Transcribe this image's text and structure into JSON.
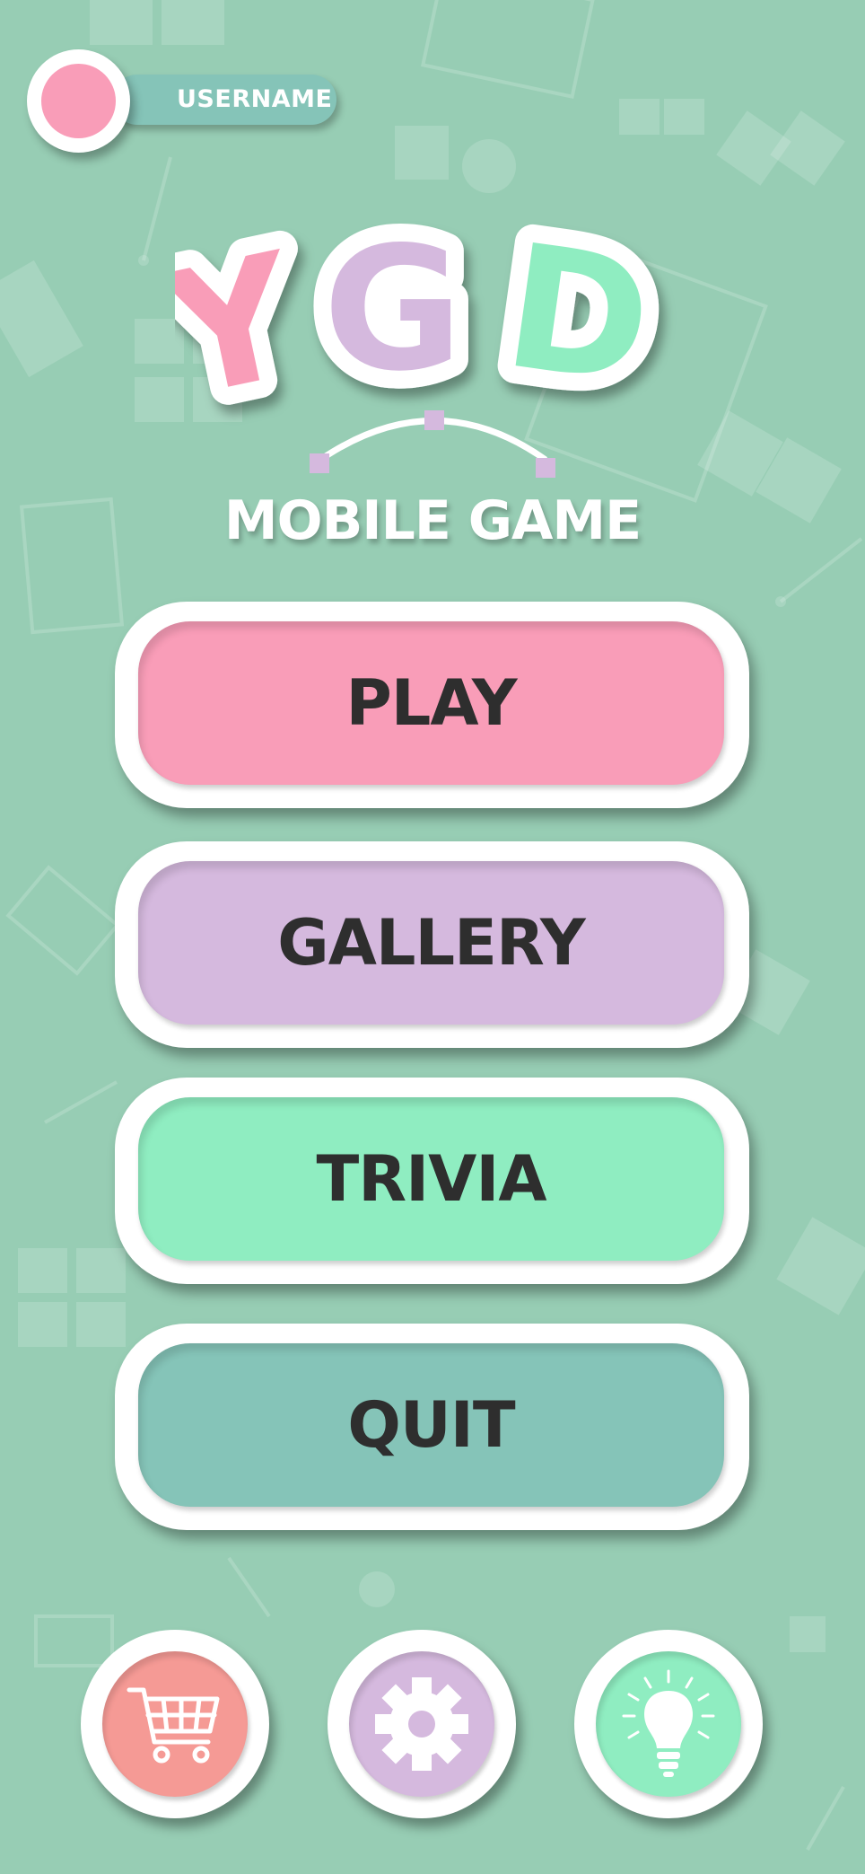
{
  "profile": {
    "username": "USERNAME",
    "avatar_color": "#f99db8"
  },
  "logo": {
    "letters": [
      "Y",
      "G",
      "D"
    ],
    "letter_colors": [
      "#f99db8",
      "#d5b9de",
      "#8fedc1"
    ],
    "subtitle": "MOBILE GAME"
  },
  "menu": {
    "play": "PLAY",
    "gallery": "GALLERY",
    "trivia": "TRIVIA",
    "quit": "QUIT"
  },
  "bottom_bar": {
    "shop_icon": "shopping-cart-icon",
    "settings_icon": "gear-icon",
    "hints_icon": "lightbulb-icon"
  },
  "colors": {
    "background": "#97cdb4",
    "pink": "#f99db8",
    "lavender": "#d5b9de",
    "mint": "#8fedc1",
    "teal": "#85c4b8",
    "salmon": "#f59a95",
    "text_dark": "#2e2e2e"
  }
}
